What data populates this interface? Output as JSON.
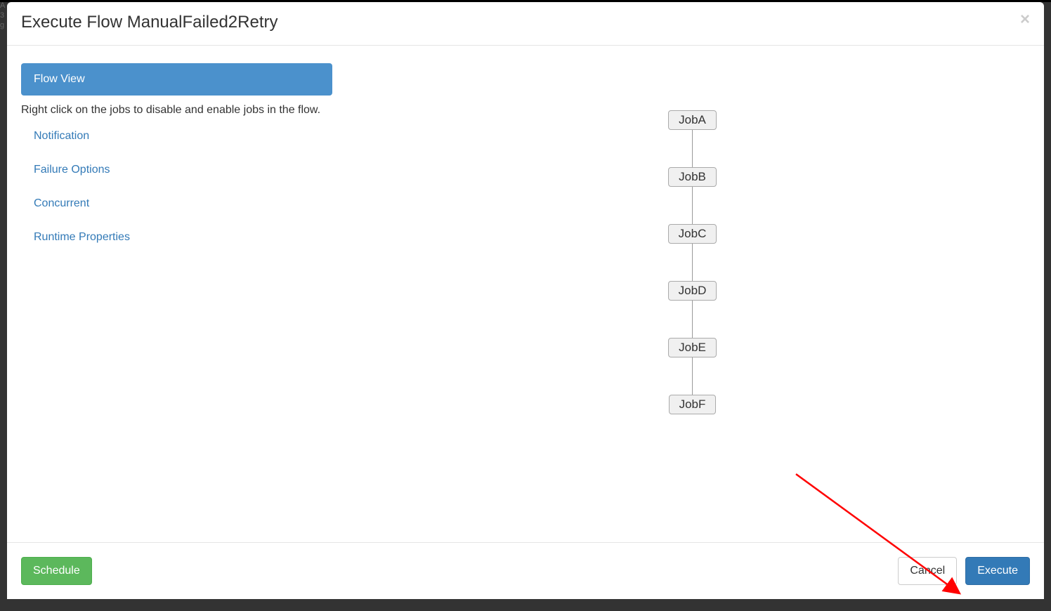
{
  "modal": {
    "title": "Execute Flow ManualFailed2Retry",
    "close_icon": "×"
  },
  "left": {
    "flow_view_label": "Flow View",
    "hint": "Right click on the jobs to disable and enable jobs in the flow.",
    "options": {
      "notification": "Notification",
      "failure": "Failure Options",
      "concurrent": "Concurrent",
      "runtime": "Runtime Properties"
    }
  },
  "jobs": {
    "a": "JobA",
    "b": "JobB",
    "c": "JobC",
    "d": "JobD",
    "e": "JobE",
    "f": "JobF"
  },
  "footer": {
    "schedule": "Schedule",
    "cancel": "Cancel",
    "execute": "Execute"
  }
}
